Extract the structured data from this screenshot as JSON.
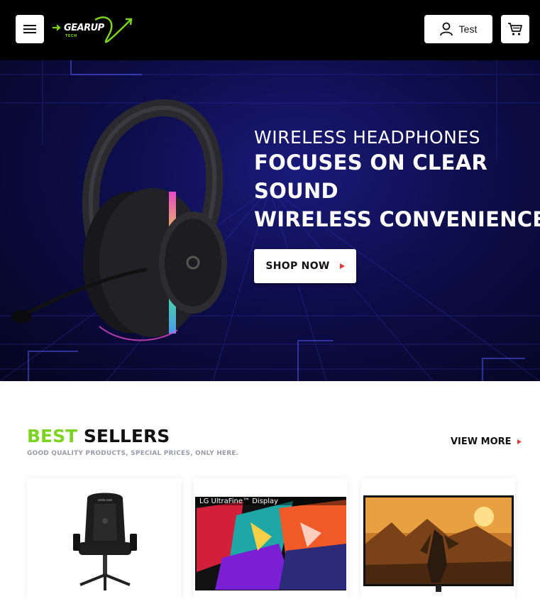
{
  "header": {
    "logo_text": "GEARUP",
    "logo_sub": "TECH",
    "account_label": "Test"
  },
  "hero": {
    "kicker": "WIRELESS HEADPHONES",
    "lines": [
      "FOCUSES ON CLEAR",
      "SOUND",
      "WIRELESS CONVENIENCE"
    ],
    "button_label": "SHOP NOW"
  },
  "best_sellers": {
    "title_accent": "BEST",
    "title_main": "SELLERS",
    "subtitle": "GOOD QUALITY PRODUCTS, SPECIAL PRICES, ONLY HERE.",
    "view_more_label": "VIEW MORE",
    "products": [
      {
        "image": "gaming-chair",
        "brand_mark": "anda seat"
      },
      {
        "image": "lg-monitor",
        "brand_mark": "LG UltraFine™ Display"
      },
      {
        "image": "gaming-monitor",
        "brand_mark": ""
      }
    ]
  },
  "colors": {
    "accent_green": "#7dd321",
    "arrow_red": "#e03a3a",
    "header_bg": "#000000",
    "hero_bg": "#0d0d4a"
  }
}
